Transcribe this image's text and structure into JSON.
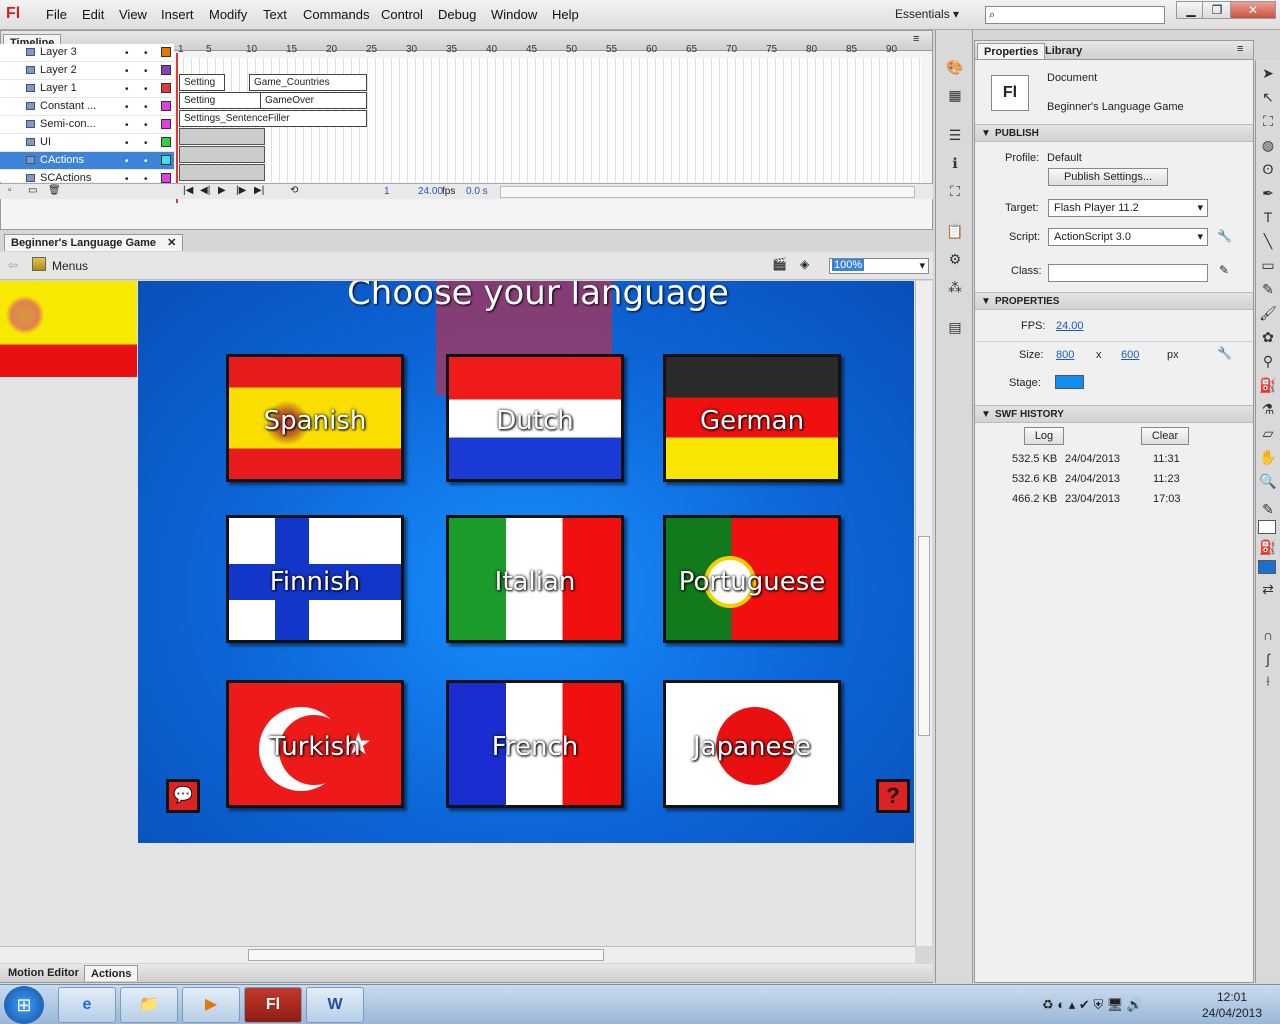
{
  "menubar": {
    "logo": "Fl",
    "items": [
      "File",
      "Edit",
      "View",
      "Insert",
      "Modify",
      "Text",
      "Commands",
      "Control",
      "Debug",
      "Window",
      "Help"
    ],
    "workspace": "Essentials",
    "window_buttons": [
      "▁",
      "❐",
      "✕"
    ]
  },
  "timeline": {
    "tab_label": "Timeline",
    "ruler": [
      "1",
      "5",
      "10",
      "15",
      "20",
      "25",
      "30",
      "35",
      "40",
      "45",
      "50",
      "55",
      "60",
      "65",
      "70",
      "75",
      "80",
      "85",
      "90"
    ],
    "layers": [
      {
        "name": "Layer 3",
        "color": "#e37a00"
      },
      {
        "name": "Layer 2",
        "color": "#8b3fb5"
      },
      {
        "name": "Layer 1",
        "color": "#e23a3a"
      },
      {
        "name": "Constant ...",
        "color": "#e040e0"
      },
      {
        "name": "Semi-con...",
        "color": "#e040e0"
      },
      {
        "name": "UI",
        "color": "#2fcf3f"
      },
      {
        "name": "CActions",
        "color": "#3fe0e0"
      },
      {
        "name": "SCActions",
        "color": "#e040e0"
      }
    ],
    "frame_labels": {
      "layer3_a": "Setting",
      "layer3_b": "Game_Countries",
      "layer2_a": "Setting",
      "layer2_b": "GameOver",
      "layer1_a": "Settings_SentenceFiller"
    },
    "footer": {
      "frame": "1",
      "fps": "24.00",
      "fps_unit": "fps",
      "time": "0.0 s"
    }
  },
  "document": {
    "tab_title": "Beginner's Language Game",
    "scene_label": "Menus",
    "zoom": "100%"
  },
  "stage": {
    "title": "Choose your language",
    "buttons": [
      {
        "label": "Spanish"
      },
      {
        "label": "Dutch"
      },
      {
        "label": "German"
      },
      {
        "label": "Finnish"
      },
      {
        "label": "Italian"
      },
      {
        "label": "Portuguese"
      },
      {
        "label": "Turkish"
      },
      {
        "label": "French"
      },
      {
        "label": "Japanese"
      }
    ],
    "help_icon": "?"
  },
  "bottom_tabs": [
    "Motion Editor",
    "Actions"
  ],
  "properties": {
    "tabs": [
      "Properties",
      "Library"
    ],
    "doc_type": "Document",
    "doc_name": "Beginner's Language Game",
    "publish": {
      "header": "PUBLISH",
      "profile_label": "Profile:",
      "profile_value": "Default",
      "publish_settings_button": "Publish Settings...",
      "target_label": "Target:",
      "target_value": "Flash Player 11.2",
      "script_label": "Script:",
      "script_value": "ActionScript 3.0",
      "class_label": "Class:"
    },
    "properties_section": {
      "header": "PROPERTIES",
      "fps_label": "FPS:",
      "fps_value": "24.00",
      "size_label": "Size:",
      "width": "800",
      "x": "x",
      "height": "600",
      "unit": "px",
      "stage_label": "Stage:",
      "stage_color": "#0f8ff0"
    },
    "swf_history": {
      "header": "SWF HISTORY",
      "log_button": "Log",
      "clear_button": "Clear",
      "rows": [
        {
          "size": "532.5 KB",
          "date": "24/04/2013",
          "time": "11:31"
        },
        {
          "size": "532.6 KB",
          "date": "24/04/2013",
          "time": "11:23"
        },
        {
          "size": "466.2 KB",
          "date": "23/04/2013",
          "time": "17:03"
        }
      ]
    }
  },
  "taskbar": {
    "clock_time": "12:01",
    "clock_date": "24/04/2013",
    "apps": [
      "e",
      "📁",
      "▶",
      "Fl",
      "W"
    ]
  }
}
